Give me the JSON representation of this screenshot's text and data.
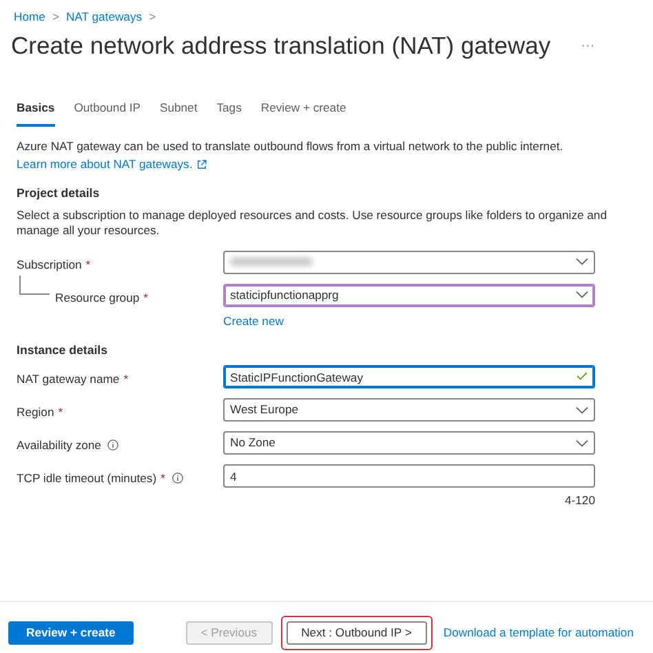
{
  "breadcrumb": [
    {
      "label": "Home"
    },
    {
      "label": "NAT gateways"
    }
  ],
  "breadcrumb_separator": ">",
  "title": "Create network address translation (NAT) gateway",
  "more_menu": "···",
  "tabs": [
    {
      "label": "Basics",
      "selected": true
    },
    {
      "label": "Outbound IP",
      "selected": false
    },
    {
      "label": "Subnet",
      "selected": false
    },
    {
      "label": "Tags",
      "selected": false
    },
    {
      "label": "Review + create",
      "selected": false
    }
  ],
  "intro": "Azure NAT gateway can be used to translate outbound flows from a virtual network to the public internet.",
  "learn_more": "Learn more about NAT gateways.",
  "sections": [
    {
      "heading": "Project details",
      "description": "Select a subscription to manage deployed resources and costs. Use resource groups like folders to organize and manage all your resources.",
      "fields": [
        {
          "kind": "select",
          "label": "Subscription",
          "required_mark": "*",
          "value_blurred": true
        },
        {
          "kind": "select",
          "label": "Resource group",
          "required_mark": "*",
          "indented": true,
          "value": "staticipfunctionapprg",
          "hovered": true,
          "link": "Create new"
        }
      ]
    },
    {
      "heading": "Instance details",
      "fields": [
        {
          "kind": "text",
          "label": "NAT gateway name",
          "required_mark": "*",
          "value": "StaticIPFunctionGateway",
          "focused": true,
          "valid": true
        },
        {
          "kind": "select",
          "label": "Region",
          "required_mark": "*",
          "value": "West Europe"
        },
        {
          "kind": "select",
          "label": "Availability zone",
          "info": true,
          "value": "No Zone"
        },
        {
          "kind": "text",
          "label": "TCP idle timeout (minutes)",
          "required_mark": "*",
          "info": true,
          "value": "4",
          "hint": "4-120"
        }
      ]
    }
  ],
  "footer": {
    "buttons": [
      {
        "kind": "primary",
        "label": "Review + create",
        "disabled": false
      },
      {
        "kind": "secondary",
        "label": "< Previous",
        "disabled": true
      },
      {
        "kind": "secondary",
        "label": "Next : Outbound IP >",
        "disabled": false,
        "highlighted": true
      }
    ],
    "link": "Download a template for automation"
  }
}
